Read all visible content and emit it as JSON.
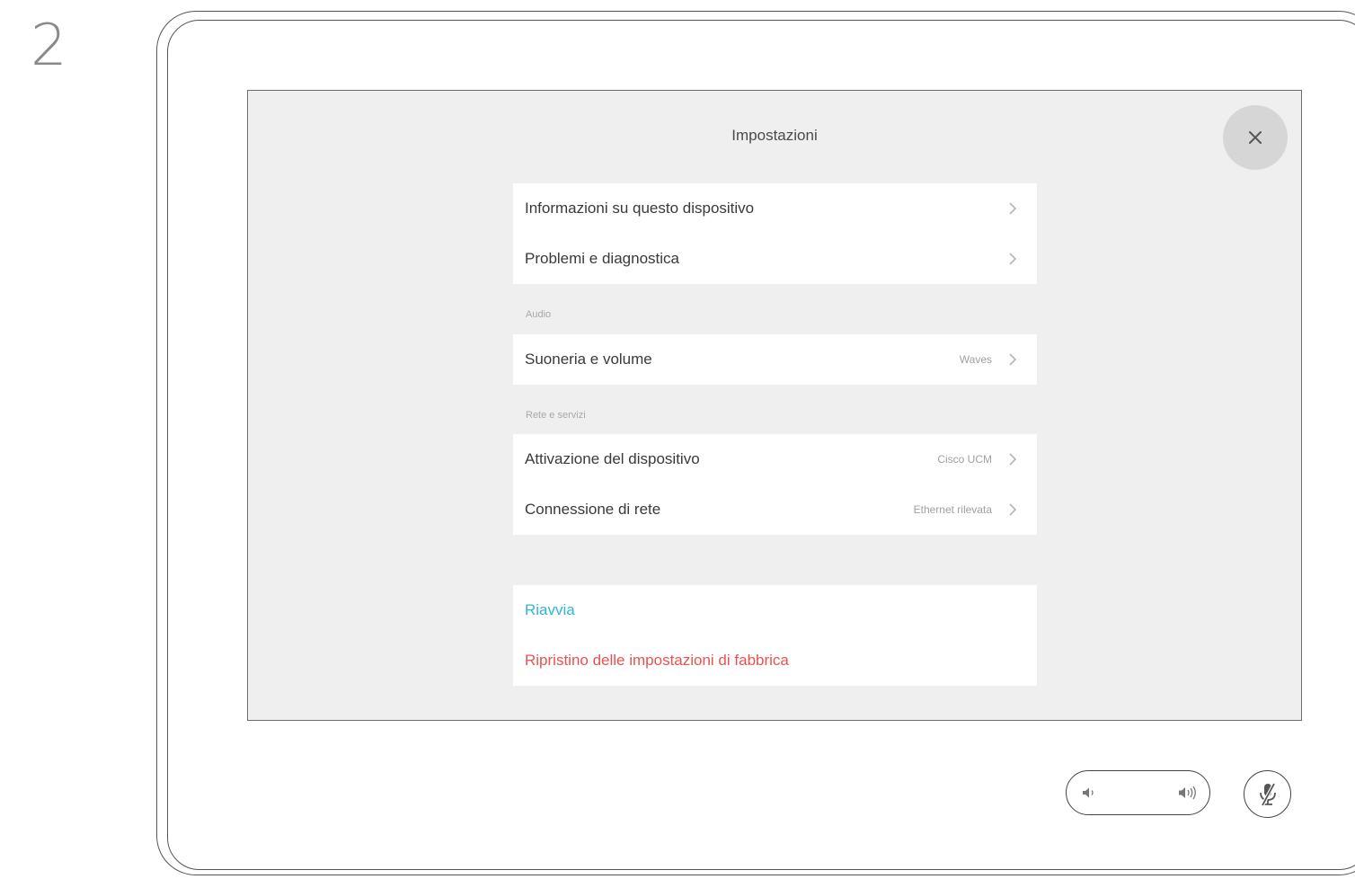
{
  "step_number": "2",
  "screen": {
    "title": "Impostazioni",
    "close_icon": "close-icon"
  },
  "groups": {
    "general": [
      {
        "label": "Informazioni su questo dispositivo",
        "value": ""
      },
      {
        "label": "Problemi e diagnostica",
        "value": ""
      }
    ],
    "audio_header": "Audio",
    "audio": [
      {
        "label": "Suoneria e volume",
        "value": "Waves"
      }
    ],
    "network_header": "Rete e servizi",
    "network": [
      {
        "label": "Attivazione del dispositivo",
        "value": "Cisco UCM"
      },
      {
        "label": "Connessione di rete",
        "value": "Ethernet rilevata"
      }
    ],
    "actions": [
      {
        "label": "Riavvia",
        "color": "#2fb6d6"
      },
      {
        "label": "Ripristino delle impostazioni di fabbrica",
        "color": "#e8534f"
      }
    ]
  },
  "controls": {
    "volume_down_icon": "volume-down-icon",
    "volume_up_icon": "volume-up-icon",
    "mute_icon": "microphone-muted-icon"
  }
}
